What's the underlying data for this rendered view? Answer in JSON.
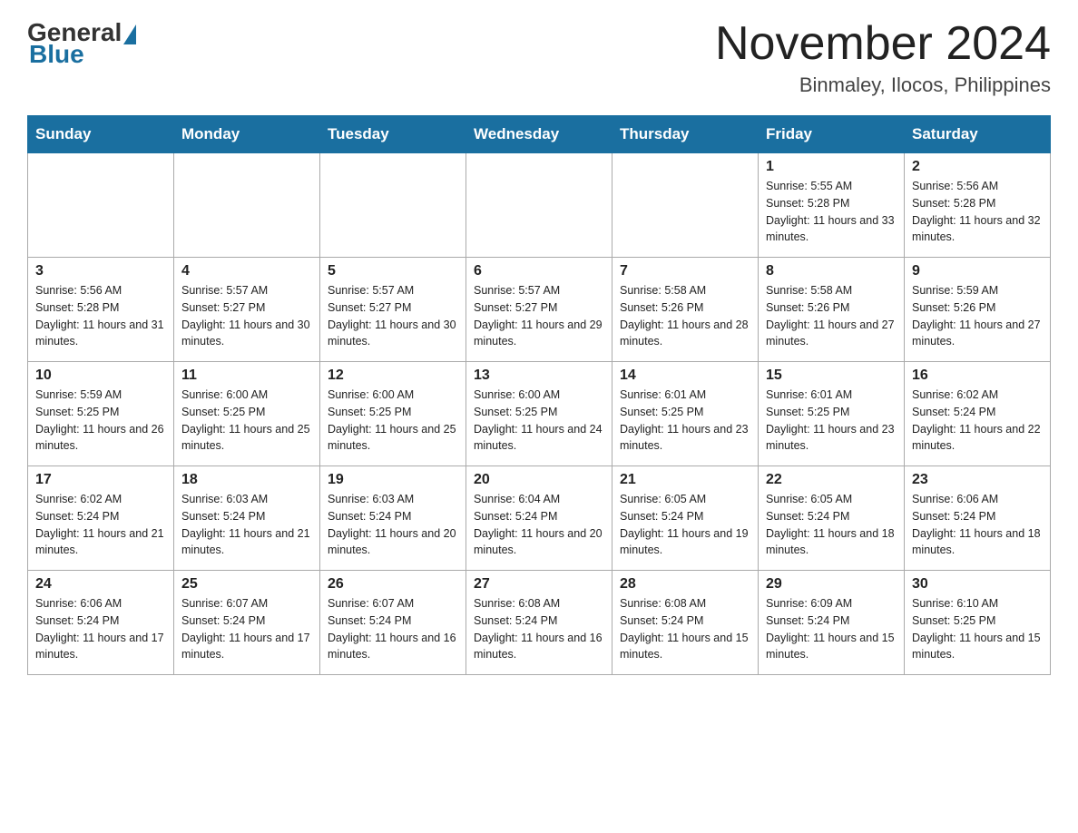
{
  "header": {
    "logo": {
      "general": "General",
      "blue": "Blue"
    },
    "title": "November 2024",
    "subtitle": "Binmaley, Ilocos, Philippines"
  },
  "days_of_week": [
    "Sunday",
    "Monday",
    "Tuesday",
    "Wednesday",
    "Thursday",
    "Friday",
    "Saturday"
  ],
  "weeks": [
    {
      "days": [
        {
          "num": "",
          "info": ""
        },
        {
          "num": "",
          "info": ""
        },
        {
          "num": "",
          "info": ""
        },
        {
          "num": "",
          "info": ""
        },
        {
          "num": "",
          "info": ""
        },
        {
          "num": "1",
          "info": "Sunrise: 5:55 AM\nSunset: 5:28 PM\nDaylight: 11 hours and 33 minutes."
        },
        {
          "num": "2",
          "info": "Sunrise: 5:56 AM\nSunset: 5:28 PM\nDaylight: 11 hours and 32 minutes."
        }
      ]
    },
    {
      "days": [
        {
          "num": "3",
          "info": "Sunrise: 5:56 AM\nSunset: 5:28 PM\nDaylight: 11 hours and 31 minutes."
        },
        {
          "num": "4",
          "info": "Sunrise: 5:57 AM\nSunset: 5:27 PM\nDaylight: 11 hours and 30 minutes."
        },
        {
          "num": "5",
          "info": "Sunrise: 5:57 AM\nSunset: 5:27 PM\nDaylight: 11 hours and 30 minutes."
        },
        {
          "num": "6",
          "info": "Sunrise: 5:57 AM\nSunset: 5:27 PM\nDaylight: 11 hours and 29 minutes."
        },
        {
          "num": "7",
          "info": "Sunrise: 5:58 AM\nSunset: 5:26 PM\nDaylight: 11 hours and 28 minutes."
        },
        {
          "num": "8",
          "info": "Sunrise: 5:58 AM\nSunset: 5:26 PM\nDaylight: 11 hours and 27 minutes."
        },
        {
          "num": "9",
          "info": "Sunrise: 5:59 AM\nSunset: 5:26 PM\nDaylight: 11 hours and 27 minutes."
        }
      ]
    },
    {
      "days": [
        {
          "num": "10",
          "info": "Sunrise: 5:59 AM\nSunset: 5:25 PM\nDaylight: 11 hours and 26 minutes."
        },
        {
          "num": "11",
          "info": "Sunrise: 6:00 AM\nSunset: 5:25 PM\nDaylight: 11 hours and 25 minutes."
        },
        {
          "num": "12",
          "info": "Sunrise: 6:00 AM\nSunset: 5:25 PM\nDaylight: 11 hours and 25 minutes."
        },
        {
          "num": "13",
          "info": "Sunrise: 6:00 AM\nSunset: 5:25 PM\nDaylight: 11 hours and 24 minutes."
        },
        {
          "num": "14",
          "info": "Sunrise: 6:01 AM\nSunset: 5:25 PM\nDaylight: 11 hours and 23 minutes."
        },
        {
          "num": "15",
          "info": "Sunrise: 6:01 AM\nSunset: 5:25 PM\nDaylight: 11 hours and 23 minutes."
        },
        {
          "num": "16",
          "info": "Sunrise: 6:02 AM\nSunset: 5:24 PM\nDaylight: 11 hours and 22 minutes."
        }
      ]
    },
    {
      "days": [
        {
          "num": "17",
          "info": "Sunrise: 6:02 AM\nSunset: 5:24 PM\nDaylight: 11 hours and 21 minutes."
        },
        {
          "num": "18",
          "info": "Sunrise: 6:03 AM\nSunset: 5:24 PM\nDaylight: 11 hours and 21 minutes."
        },
        {
          "num": "19",
          "info": "Sunrise: 6:03 AM\nSunset: 5:24 PM\nDaylight: 11 hours and 20 minutes."
        },
        {
          "num": "20",
          "info": "Sunrise: 6:04 AM\nSunset: 5:24 PM\nDaylight: 11 hours and 20 minutes."
        },
        {
          "num": "21",
          "info": "Sunrise: 6:05 AM\nSunset: 5:24 PM\nDaylight: 11 hours and 19 minutes."
        },
        {
          "num": "22",
          "info": "Sunrise: 6:05 AM\nSunset: 5:24 PM\nDaylight: 11 hours and 18 minutes."
        },
        {
          "num": "23",
          "info": "Sunrise: 6:06 AM\nSunset: 5:24 PM\nDaylight: 11 hours and 18 minutes."
        }
      ]
    },
    {
      "days": [
        {
          "num": "24",
          "info": "Sunrise: 6:06 AM\nSunset: 5:24 PM\nDaylight: 11 hours and 17 minutes."
        },
        {
          "num": "25",
          "info": "Sunrise: 6:07 AM\nSunset: 5:24 PM\nDaylight: 11 hours and 17 minutes."
        },
        {
          "num": "26",
          "info": "Sunrise: 6:07 AM\nSunset: 5:24 PM\nDaylight: 11 hours and 16 minutes."
        },
        {
          "num": "27",
          "info": "Sunrise: 6:08 AM\nSunset: 5:24 PM\nDaylight: 11 hours and 16 minutes."
        },
        {
          "num": "28",
          "info": "Sunrise: 6:08 AM\nSunset: 5:24 PM\nDaylight: 11 hours and 15 minutes."
        },
        {
          "num": "29",
          "info": "Sunrise: 6:09 AM\nSunset: 5:24 PM\nDaylight: 11 hours and 15 minutes."
        },
        {
          "num": "30",
          "info": "Sunrise: 6:10 AM\nSunset: 5:25 PM\nDaylight: 11 hours and 15 minutes."
        }
      ]
    }
  ]
}
